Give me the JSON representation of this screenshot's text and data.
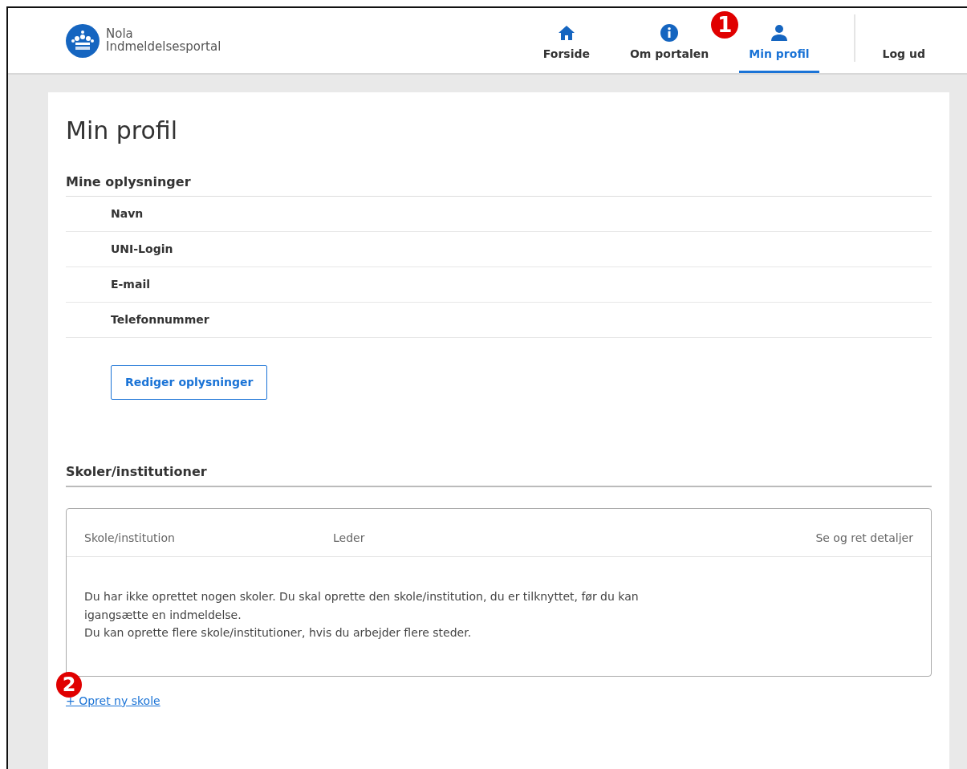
{
  "brand": {
    "line1": "Nola",
    "line2": "Indmeldelsesportal"
  },
  "nav": [
    {
      "label": "Forside",
      "kind": "home",
      "selected": false
    },
    {
      "label": "Om portalen",
      "kind": "info",
      "selected": false
    },
    {
      "label": "Min profil",
      "kind": "person",
      "selected": true,
      "callout": "1"
    }
  ],
  "logout": "Log ud",
  "page_title": "Min profil",
  "info_section": {
    "title": "Mine oplysninger",
    "fields": [
      "Navn",
      "UNI-Login",
      "E-mail",
      "Telefonnummer"
    ],
    "edit_button": "Rediger oplysninger"
  },
  "schools_section": {
    "title": "Skoler/institutioner",
    "columns": [
      "Skole/institution",
      "Leder",
      "Se og ret detaljer"
    ],
    "empty_lines": [
      "Du har ikke oprettet nogen skoler. Du skal oprette den skole/institution, du er tilknyttet, før du kan igangsætte en indmeldelse.",
      "Du kan oprette flere skole/institutioner, hvis du arbejder flere steder."
    ],
    "create_callout": "2",
    "create_link": "+ Opret ny skole"
  }
}
